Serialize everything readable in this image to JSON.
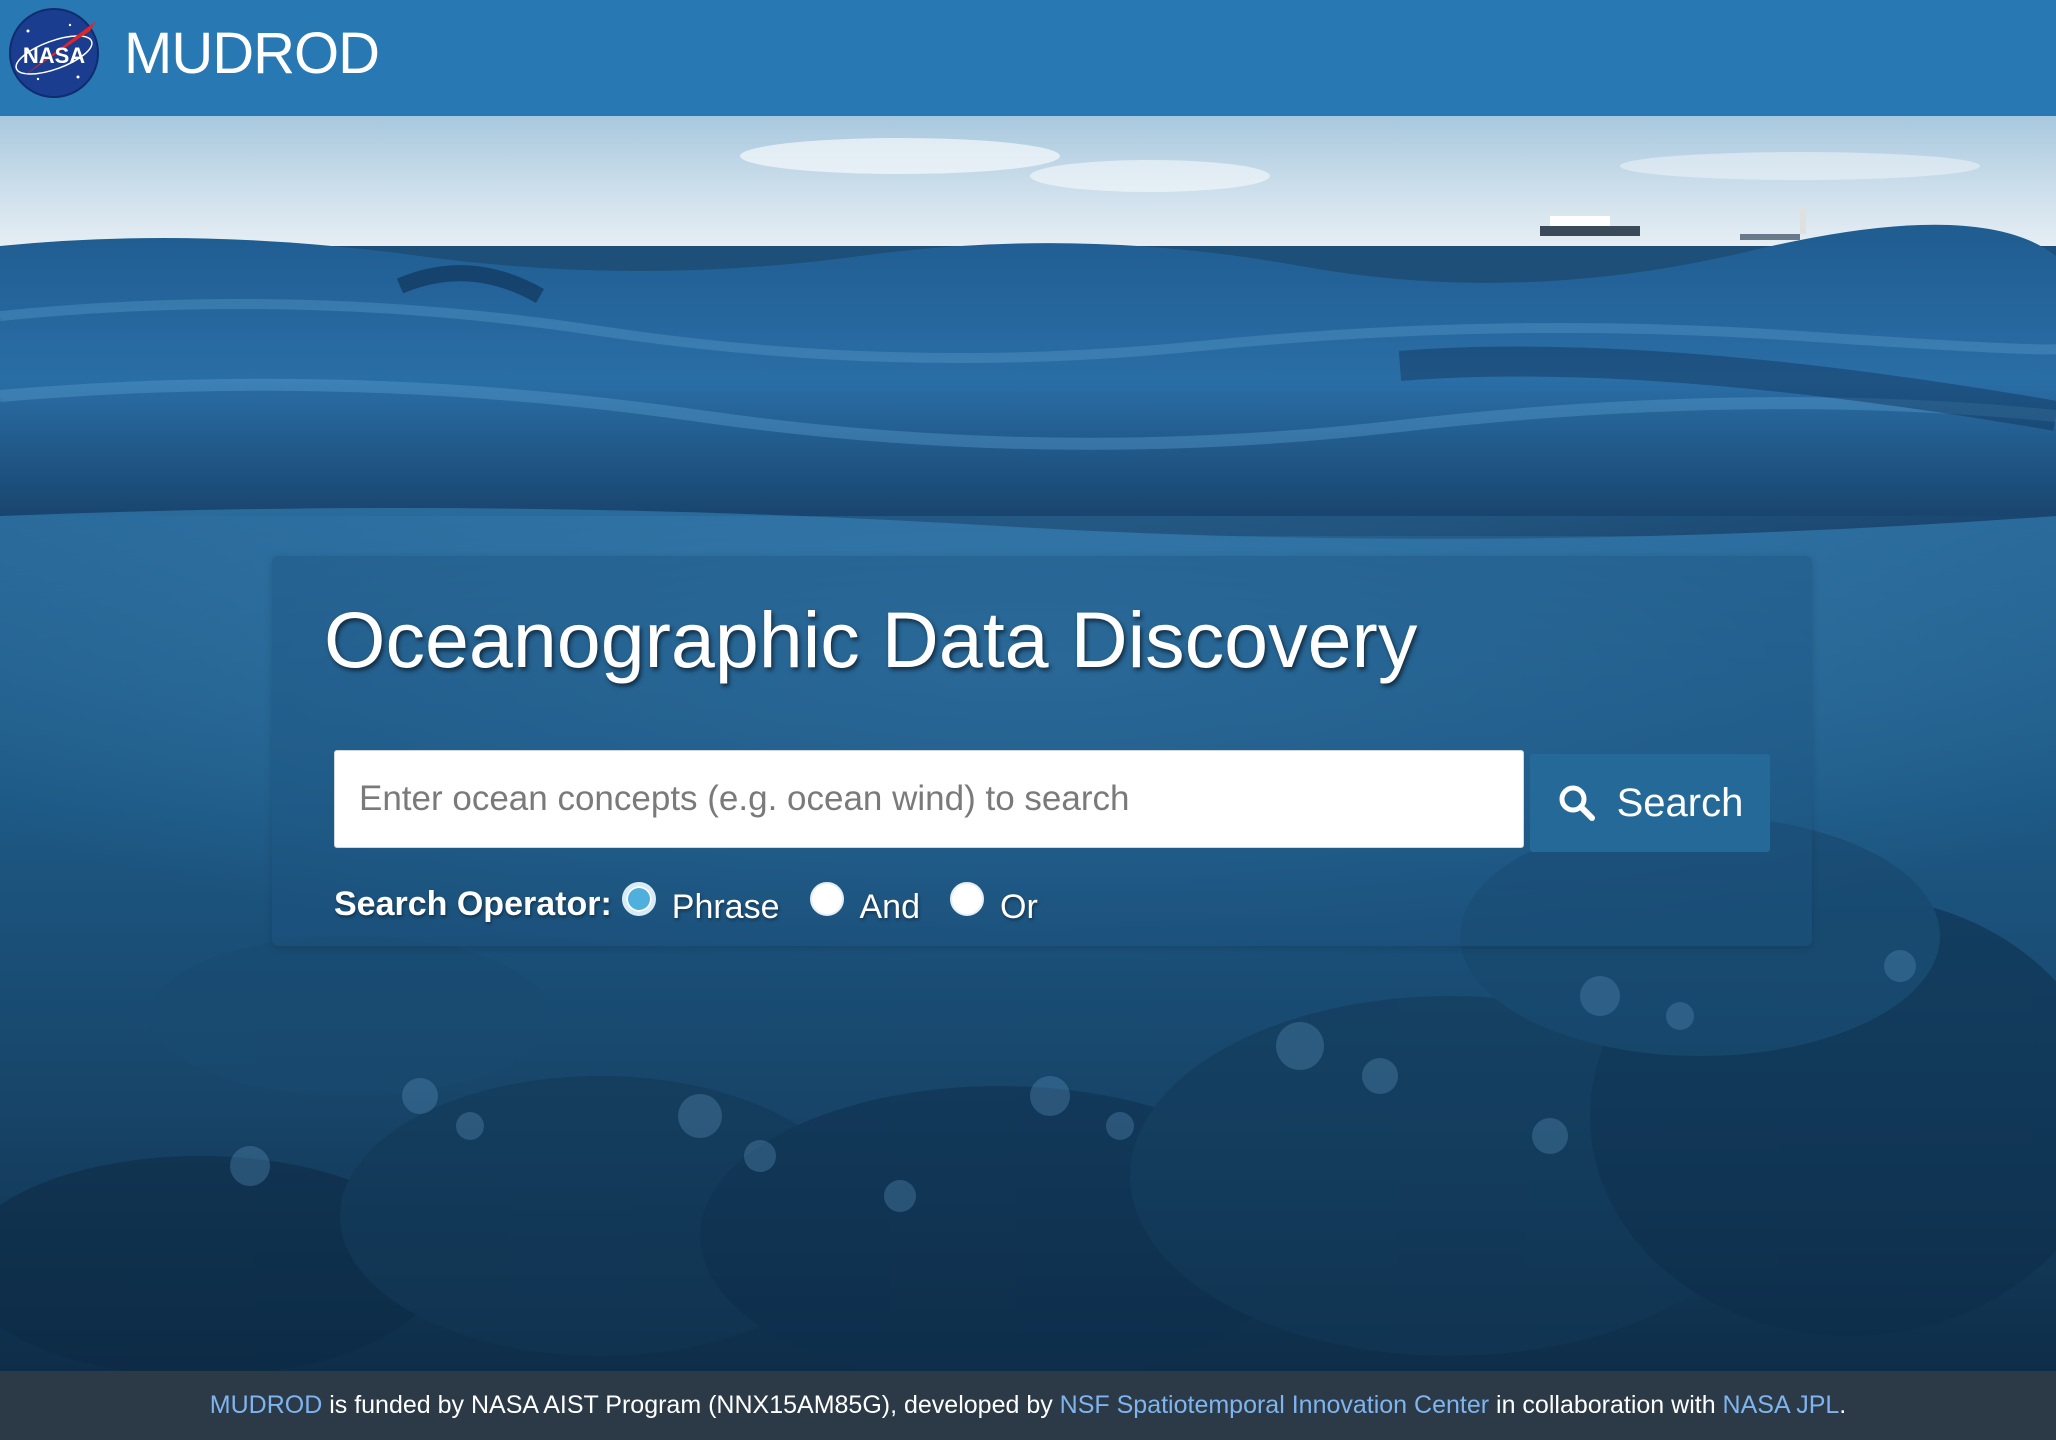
{
  "navbar": {
    "logo_text": "NASA",
    "brand": "MUDROD"
  },
  "hero": {
    "title": "Oceanographic Data Discovery",
    "search": {
      "placeholder": "Enter ocean concepts (e.g. ocean wind) to search",
      "value": "",
      "button_label": "Search",
      "button_icon": "search-icon"
    },
    "operator": {
      "label": "Search Operator:",
      "options": [
        {
          "label": "Phrase",
          "checked": true
        },
        {
          "label": "And",
          "checked": false
        },
        {
          "label": "Or",
          "checked": false
        }
      ]
    }
  },
  "footer": {
    "link_mudrod": "MUDROD",
    "text_1": " is funded by NASA AIST Program (NNX15AM85G), developed by ",
    "link_nsf": "NSF Spatiotemporal Innovation Center",
    "text_2": " in collaboration with ",
    "link_jpl": "NASA JPL",
    "text_3": "."
  },
  "colors": {
    "navbar": "#2878b4",
    "footer": "#2b3a46",
    "link": "#7fb4ee",
    "button": "#246997"
  }
}
